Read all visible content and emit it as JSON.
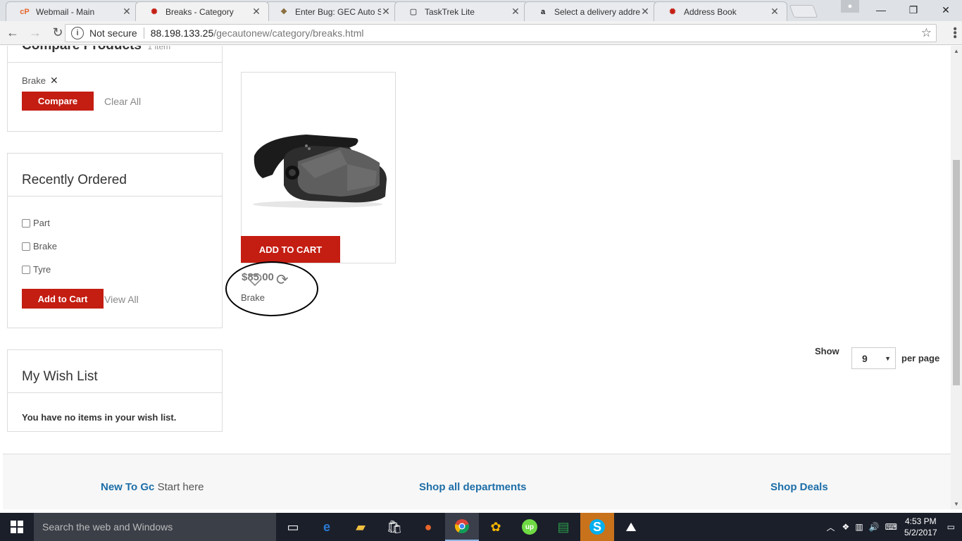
{
  "browser": {
    "tabs": [
      {
        "title": "Webmail - Main",
        "icon": "cpanel-icon"
      },
      {
        "title": "Breaks - Category",
        "icon": "site-icon"
      },
      {
        "title": "Enter Bug: GEC Auto Su",
        "icon": "bugzilla-icon"
      },
      {
        "title": "TaskTrek Lite",
        "icon": "page-icon"
      },
      {
        "title": "Select a delivery addres",
        "icon": "amazon-icon"
      },
      {
        "title": "Address Book",
        "icon": "site-icon"
      }
    ],
    "security": "Not secure",
    "url_host": "88.198.133.25",
    "url_path": "/gecautonew/category/breaks.html"
  },
  "sidebar": {
    "compare": {
      "title": "Compare Products",
      "count": "1 item",
      "items": [
        "Brake"
      ],
      "compare_label": "Compare",
      "clear_label": "Clear All"
    },
    "recent": {
      "title": "Recently Ordered",
      "items": [
        "Part",
        "Brake",
        "Tyre"
      ],
      "add_label": "Add to Cart",
      "view_label": "View All"
    },
    "wishlist": {
      "title": "My Wish List",
      "empty_text": "You have no items in your wish list."
    }
  },
  "product": {
    "add_to_cart": "ADD TO CART",
    "price": "$85.00",
    "name": "Brake"
  },
  "toolbar": {
    "show_label": "Show",
    "per_page_value": "9",
    "per_page_label": "per page"
  },
  "footer": {
    "new_to": "New To Gc",
    "start_here": "Start here",
    "shop_all": "Shop all departments",
    "shop_deals": "Shop Deals"
  },
  "taskbar": {
    "search_placeholder": "Search the web and Windows",
    "time": "4:53 PM",
    "date": "5/2/2017"
  },
  "colors": {
    "accent_red": "#c41d12",
    "link_blue": "#1d6ea8"
  }
}
